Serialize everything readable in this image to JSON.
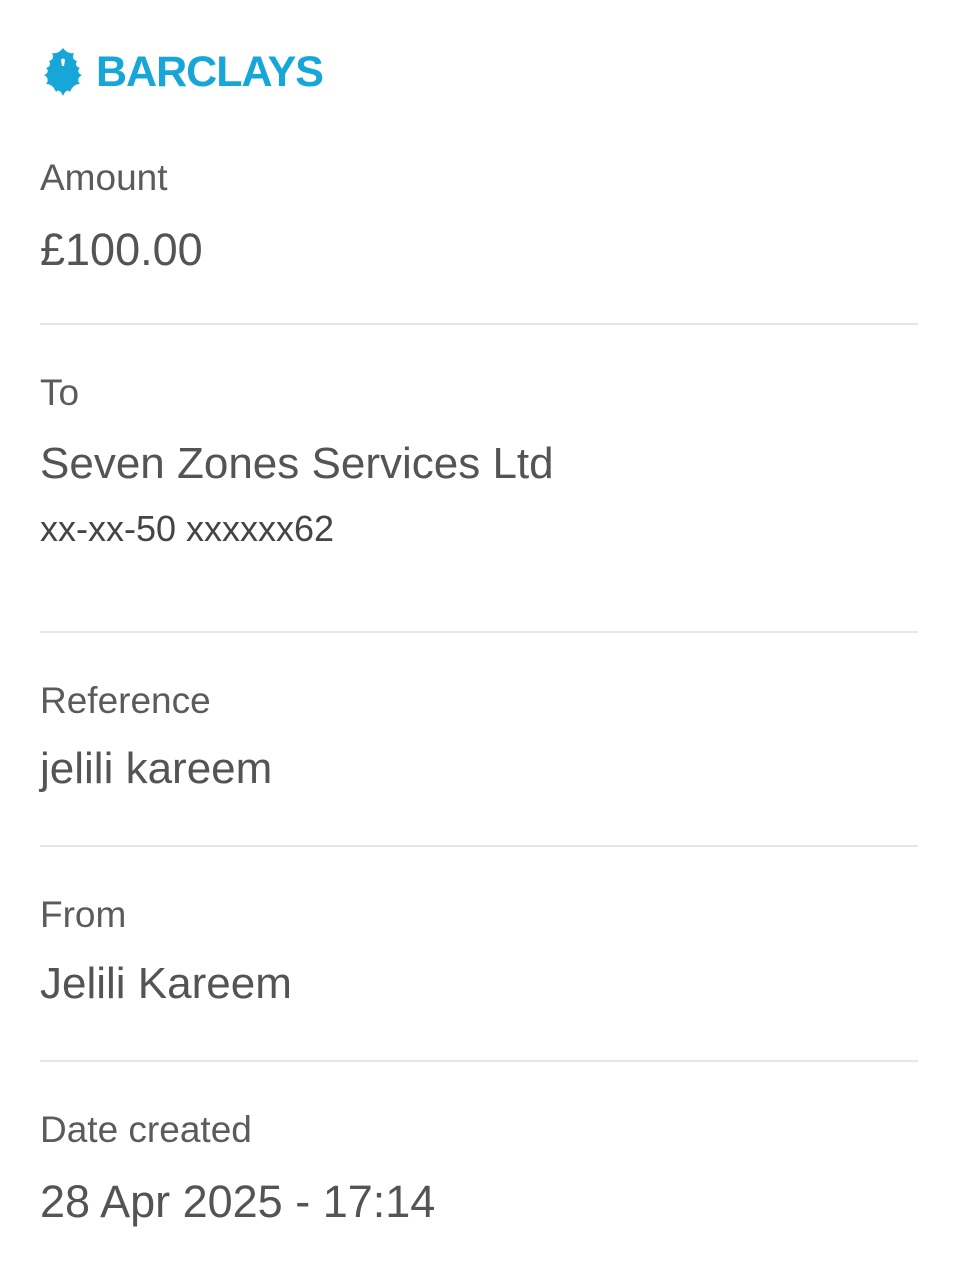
{
  "brand": {
    "name": "BARCLAYS",
    "logo_icon": "eagle-icon",
    "color": "#17a6d8"
  },
  "amount": {
    "label": "Amount",
    "value": "£100.00"
  },
  "to": {
    "label": "To",
    "name": "Seven Zones Services Ltd",
    "account": "xx-xx-50 xxxxxx62"
  },
  "reference": {
    "label": "Reference",
    "value": "jelili kareem"
  },
  "from": {
    "label": "From",
    "value": "Jelili Kareem"
  },
  "date_created": {
    "label": "Date created",
    "value": "28 Apr 2025 - 17:14"
  }
}
